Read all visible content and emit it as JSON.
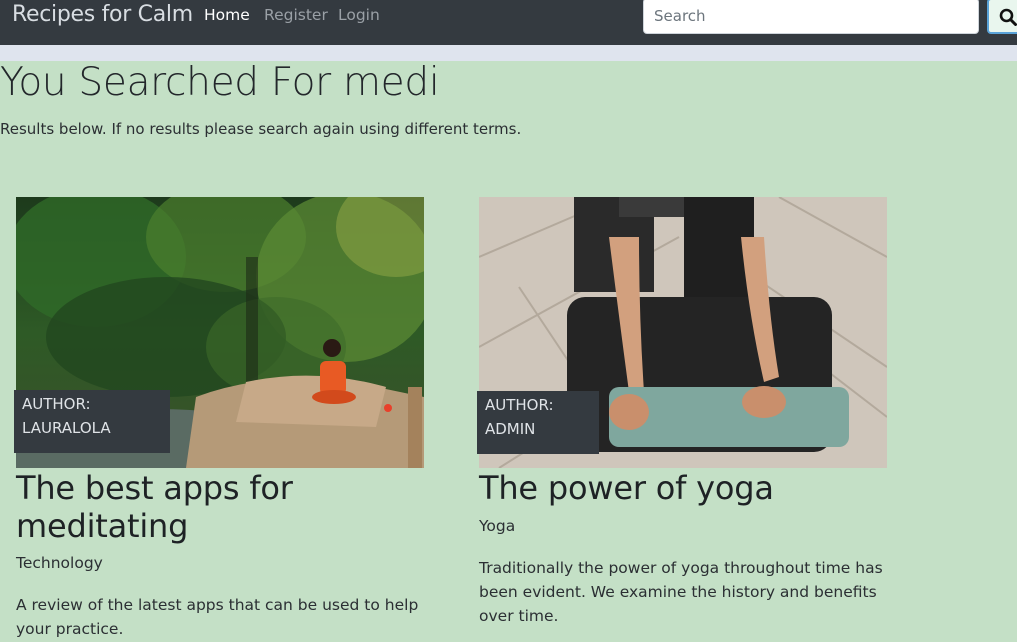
{
  "nav": {
    "brand": "Recipes for Calm",
    "links": [
      {
        "label": "Home",
        "active": true
      },
      {
        "label": "Register",
        "active": false
      },
      {
        "label": "Login",
        "active": false
      }
    ],
    "search": {
      "placeholder": "Search",
      "value": "",
      "button_icon": "search-icon"
    }
  },
  "page": {
    "title": "You Searched For medi",
    "subtitle": "Results below. If no results please search again using different terms."
  },
  "results": [
    {
      "image_desc": "woman-meditating-in-forest",
      "author_label": "AUTHOR:",
      "author_name": "LAURALOLA",
      "title": "The best apps for meditating",
      "category": "Technology",
      "description": "A review of the latest apps that can be used to help your practice."
    },
    {
      "image_desc": "person-rolling-yoga-mat",
      "author_label": "AUTHOR:",
      "author_name": "ADMIN",
      "title": "The power of yoga",
      "category": "Yoga",
      "description": "Traditionally the power of yoga throughout time has been evident. We examine the history and benefits over time."
    }
  ],
  "colors": {
    "navbar": "#343a40",
    "background": "#c4e0c6",
    "author_badge": "#343a40"
  }
}
